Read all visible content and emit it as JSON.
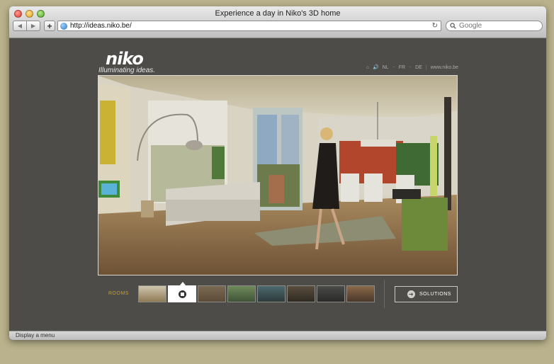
{
  "window": {
    "title": "Experience a day in Niko's 3D home"
  },
  "toolbar": {
    "back_label": "◀",
    "forward_label": "▶",
    "add_label": "+",
    "url": "http://ideas.niko.be/",
    "reload_label": "↻",
    "search_placeholder": "Google"
  },
  "brand": {
    "name": "niko",
    "tagline": "Illuminating ideas."
  },
  "topnav": {
    "home": "⌂",
    "sound": "🔊",
    "languages": [
      "NL",
      "FR",
      "DE"
    ],
    "separator": "~",
    "website": "www.niko.be"
  },
  "room_strip": {
    "label": "ROOMS",
    "thumbnails": [
      {
        "name": "living-room",
        "colors": [
          "#cfc6ae",
          "#8f7a55"
        ]
      },
      {
        "name": "current",
        "active": true
      },
      {
        "name": "hallway",
        "colors": [
          "#7b6a52",
          "#5b4b38"
        ]
      },
      {
        "name": "garden",
        "colors": [
          "#6f8a5a",
          "#3f5336"
        ]
      },
      {
        "name": "terrace",
        "colors": [
          "#4b6a6c",
          "#2e3a3a"
        ]
      },
      {
        "name": "kitchen",
        "colors": [
          "#5a4e3e",
          "#2f2a22"
        ]
      },
      {
        "name": "bedroom",
        "colors": [
          "#4a4a48",
          "#2a2a2a"
        ]
      },
      {
        "name": "bathroom",
        "colors": [
          "#8a6a4a",
          "#4a3628"
        ]
      }
    ]
  },
  "solutions_label": "SOLUTIONS",
  "status_text": "Display a menu",
  "colors": {
    "accent": "#c5a22a",
    "background": "#4d4c49"
  }
}
